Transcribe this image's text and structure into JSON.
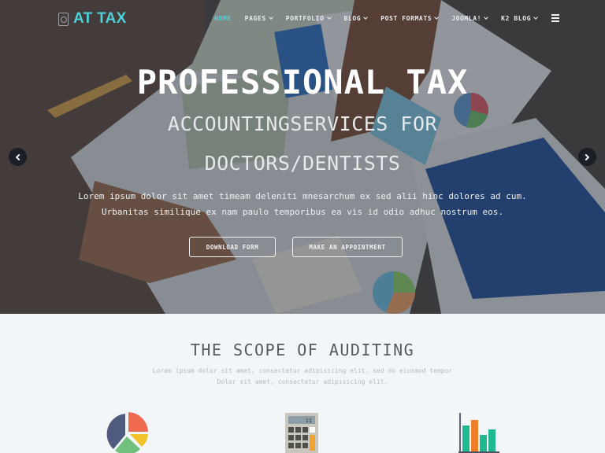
{
  "nav": {
    "logo_text": "AT TAX",
    "logo_icon": "document-badge-icon",
    "items": [
      {
        "label": "HOME",
        "active": true,
        "dropdown": false
      },
      {
        "label": "PAGES",
        "active": false,
        "dropdown": true
      },
      {
        "label": "PORTFOLIO",
        "active": false,
        "dropdown": true
      },
      {
        "label": "BLOG",
        "active": false,
        "dropdown": true
      },
      {
        "label": "POST FORMATS",
        "active": false,
        "dropdown": true
      },
      {
        "label": "JOOMLA!",
        "active": false,
        "dropdown": true
      },
      {
        "label": "K2 BLOG",
        "active": false,
        "dropdown": true
      }
    ],
    "menu_icon": "hamburger-icon"
  },
  "hero": {
    "title": "PROFESSIONAL TAX",
    "subtitle_line1": "ACCOUNTINGSERVICES FOR",
    "subtitle_line2": "DOCTORS/DENTISTS",
    "description_line1": "Lorem ipsum dolor sit amet timeam deleniti mnesarchum ex sed alii hinc dolores ad cum.",
    "description_line2": "Urbanitas similique ex nam paulo temporibus ea vis id odio adhuc nostrum eos.",
    "buttons": {
      "download": "DOWNLOAD FORM",
      "appointment": "MAKE AN APPOINTMENT"
    },
    "prev_icon": "chevron-left-icon",
    "next_icon": "chevron-right-icon"
  },
  "scope": {
    "title": "THE SCOPE OF AUDITING",
    "description_line1": "Lorem ipsum dolor sit amet, consectetur adipisicing elit, sed do eiusmod tempor",
    "description_line2": "Dolor sit amet, consectetur adipisicing elit.",
    "features": [
      {
        "icon": "pie-chart-icon"
      },
      {
        "icon": "calculator-icon",
        "display_value": "11"
      },
      {
        "icon": "bar-chart-icon"
      }
    ]
  },
  "colors": {
    "accent": "#4fd1d9",
    "section_bg": "#f3f6f9",
    "title_text": "#555a60"
  }
}
